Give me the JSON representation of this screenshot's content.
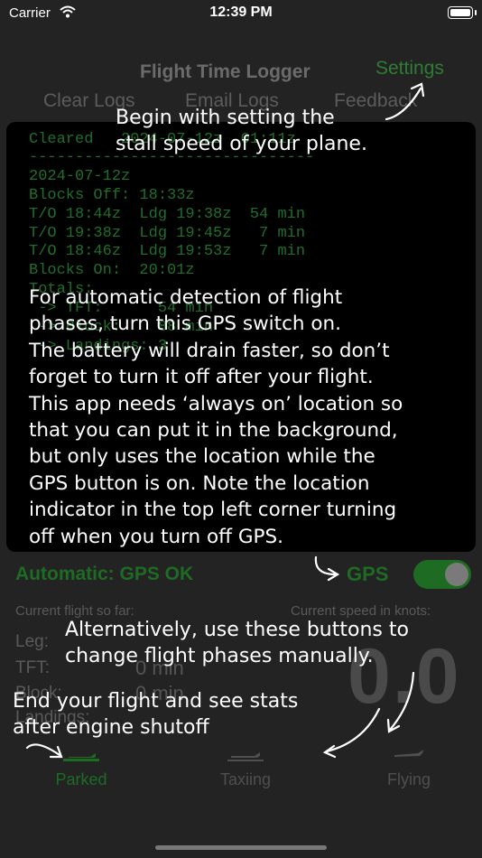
{
  "status_bar": {
    "carrier": "Carrier",
    "time": "12:39 PM"
  },
  "header": {
    "title": "Flight Time Logger",
    "settings_label": "Settings"
  },
  "menu": {
    "clear_logs": "Clear Logs",
    "email_logs": "Email Logs",
    "feedback": "Feedback"
  },
  "log": {
    "lines": [
      "Cleared   2024-07-12z  01:11z",
      "-------------------------------",
      "2024-07-12z",
      "Blocks Off: 18:33z",
      "T/O 18:44z  Ldg 19:38z  54 min",
      "T/O 19:38z  Ldg 19:45z   7 min",
      "T/O 18:46z  Ldg 19:53z   7 min",
      "Blocks On:  20:01z",
      "Totals:",
      " -> TFT:      54 min",
      " -> Block:    88 min",
      " -> Landings: 3"
    ]
  },
  "gps": {
    "status_text": "Automatic: GPS OK",
    "label": "GPS",
    "enabled": true
  },
  "stats": {
    "current_flight_label": "Current flight so far:",
    "speed_label": "Current speed in knots:",
    "leg_label": "Leg:",
    "tft_label": "TFT:",
    "block_label": "Block:",
    "landings_label": "Landings:",
    "tft_value": "0 min",
    "block_value": "0 min",
    "speed_value": "0.0"
  },
  "tabs": [
    {
      "label": "Parked",
      "active": true
    },
    {
      "label": "Taxiing",
      "active": false
    },
    {
      "label": "Flying",
      "active": false
    }
  ],
  "annotations": {
    "settings_note": [
      "Begin with setting the",
      "stall speed of your plane."
    ],
    "gps_note": [
      "For automatic detection of flight",
      "phases, turn this GPS switch on.",
      "The battery will drain faster, so don’t",
      "forget to turn it off after your flight.",
      "This app needs ‘always on’ location so",
      "that you can put it in the background,",
      "but only uses the location while the",
      "GPS button is on.  Note the location",
      "indicator in the top left corner turning",
      "off when you turn off GPS."
    ],
    "buttons_note": [
      "Alternatively, use these buttons to",
      "change flight phases manually."
    ],
    "end_note": [
      "End your flight and see stats",
      "after engine shutoff"
    ]
  },
  "colors": {
    "accent_green": "#1e6b24",
    "log_green": "#1f6f2a",
    "background": "#232323"
  }
}
